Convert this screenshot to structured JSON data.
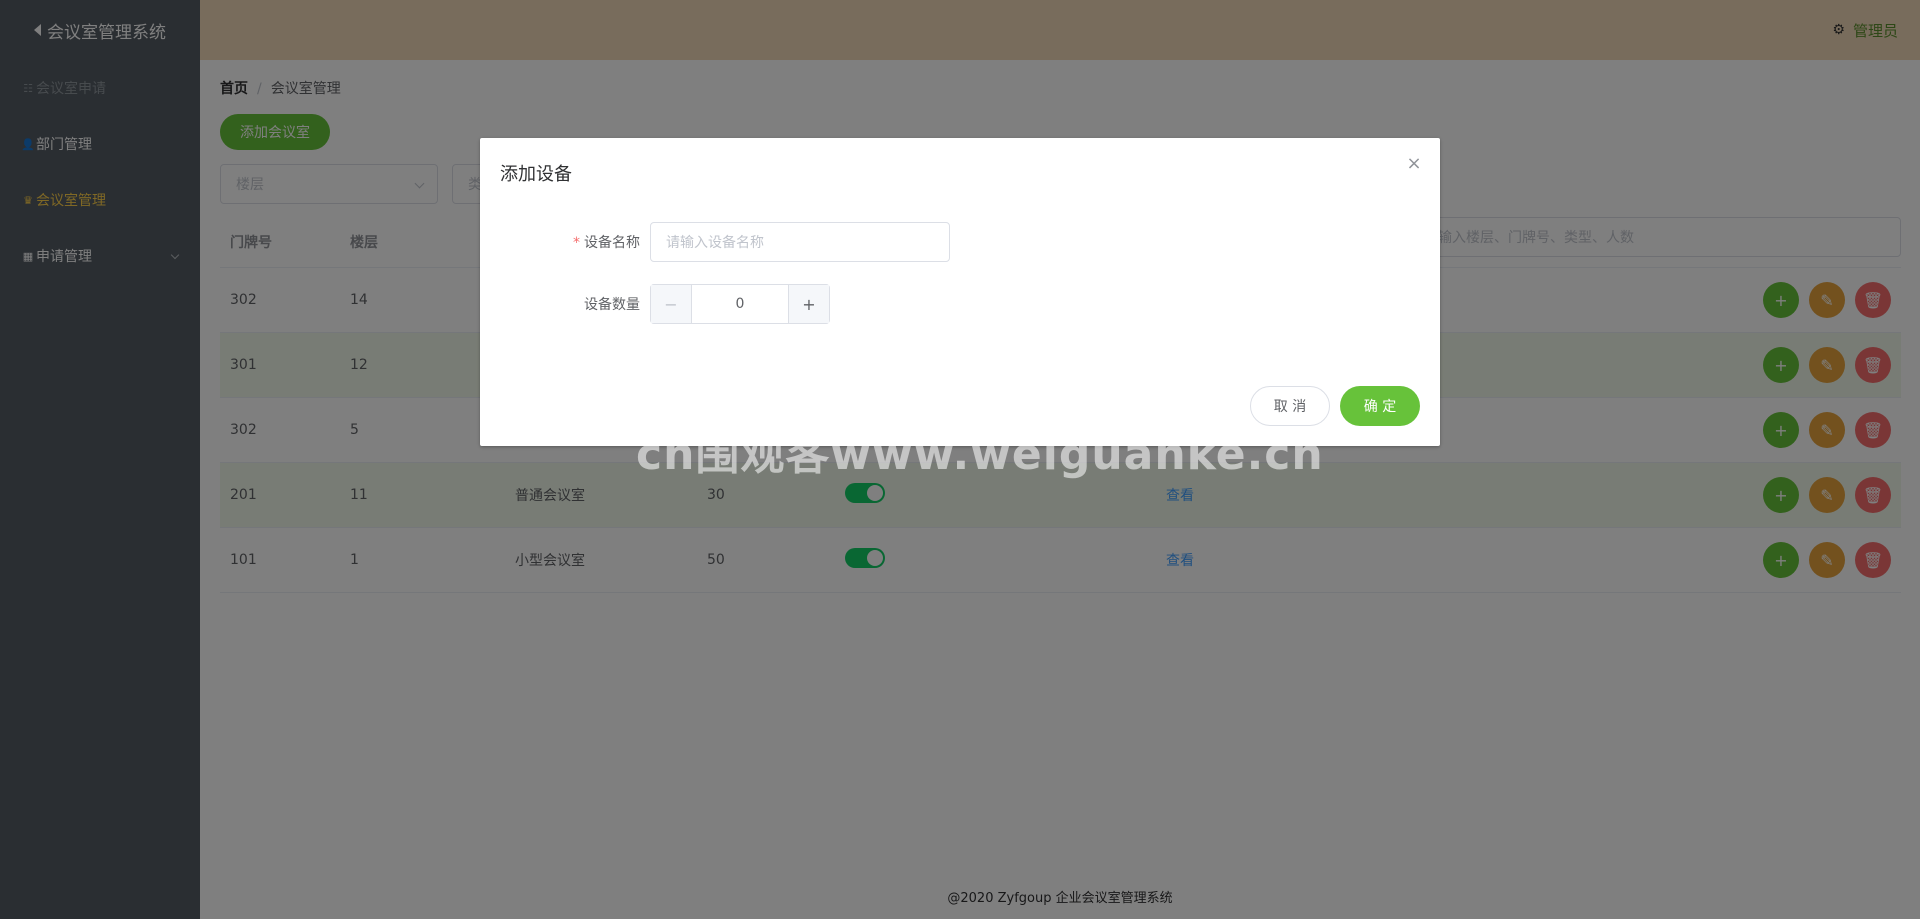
{
  "sidebar": {
    "brand": "会议室管理系统",
    "items": [
      {
        "label": "会议室申请",
        "icon": "list-icon"
      },
      {
        "label": "部门管理",
        "icon": "users-icon"
      },
      {
        "label": "会议室管理",
        "icon": "crown-icon"
      },
      {
        "label": "申请管理",
        "icon": "grid-icon"
      }
    ]
  },
  "header": {
    "user": "管理员",
    "user_icon": "gear-icon"
  },
  "breadcrumb": {
    "home": "首页",
    "sep": "/",
    "current": "会议室管理"
  },
  "toolbar": {
    "add_label": "添加会议室",
    "floor_placeholder": "楼层",
    "type_placeholder": "类",
    "search_placeholder": "输入楼层、门牌号、类型、人数"
  },
  "table": {
    "headers": [
      "门牌号",
      "楼层"
    ],
    "rows": [
      {
        "door": "302",
        "floor": "14",
        "type": "",
        "capacity": "",
        "device": ""
      },
      {
        "door": "301",
        "floor": "12",
        "type": "",
        "capacity": "",
        "device": ""
      },
      {
        "door": "302",
        "floor": "5",
        "type": "",
        "capacity": "",
        "device": ""
      },
      {
        "door": "201",
        "floor": "11",
        "type": "普通会议室",
        "capacity": "30",
        "device": "查看"
      },
      {
        "door": "101",
        "floor": "1",
        "type": "小型会议室",
        "capacity": "50",
        "device": "查看"
      }
    ]
  },
  "footer": "@2020 Zyfgoup 企业会议室管理系统",
  "dialog": {
    "title": "添加设备",
    "name_label": "设备名称",
    "name_placeholder": "请输入设备名称",
    "count_label": "设备数量",
    "count_value": "0",
    "cancel": "取 消",
    "confirm": "确 定"
  },
  "watermark": "cn围观客www.weiguanke.cn",
  "colors": {
    "primary": "#67c23a",
    "warning": "#e6a23c",
    "danger": "#f56c6c",
    "sidebar": "#545c64",
    "active_menu": "#ffd04b"
  }
}
